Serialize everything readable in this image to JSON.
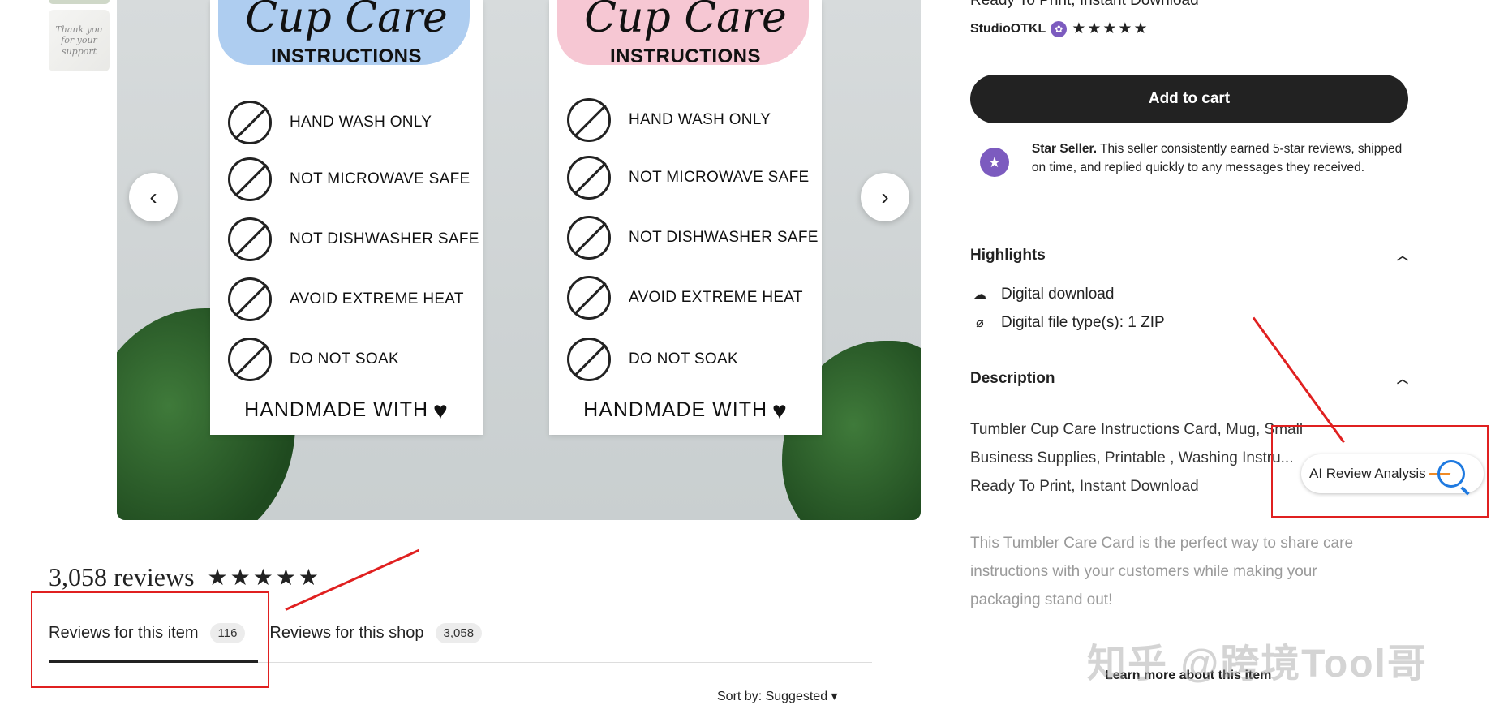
{
  "product": {
    "subtitle_cut": "Ready To Print, Instant Download",
    "seller_name": "StudioOTKL",
    "seller_badge": "✿",
    "seller_stars": "★★★★★",
    "add_to_cart": "Add to cart",
    "star_seller_label": "Star Seller.",
    "star_seller_text": "This seller consistently earned 5-star reviews, shipped on time, and replied quickly to any messages they received."
  },
  "thumbnail": {
    "caption": "Thank you for your support"
  },
  "hero_image": {
    "card_title": "Cup Care",
    "card_subtitle": "INSTRUCTIONS",
    "rules": [
      "HAND WASH ONLY",
      "NOT MICROWAVE SAFE",
      "NOT DISHWASHER SAFE",
      "AVOID EXTREME HEAT",
      "DO NOT SOAK"
    ],
    "footer": "HANDMADE WITH",
    "left_splash_color": "#aecdf0",
    "right_splash_color": "#f6c7d3",
    "prev_icon": "chevron-left-icon",
    "next_icon": "chevron-right-icon"
  },
  "highlights": {
    "heading": "Highlights",
    "items": [
      {
        "icon": "cloud-download-icon",
        "label": "Digital download"
      },
      {
        "icon": "paperclip-icon",
        "label": "Digital file type(s): 1 ZIP"
      }
    ]
  },
  "description": {
    "heading": "Description",
    "line1": "Tumbler Cup Care Instructions Card, Mug, Small",
    "line2": "Business Supplies, Printable , Washing Instru...",
    "line3": "Ready To Print, Instant Download",
    "fade1": "This Tumbler Care Card is the perfect way to share care",
    "fade2": "instructions with your customers while making your",
    "fade3": "packaging stand out!",
    "learn_more": "Learn more about this item"
  },
  "ai_widget": {
    "label": "AI Review Analysis"
  },
  "reviews": {
    "title": "3,058 reviews",
    "stars": "★★★★★",
    "tab_item_label": "Reviews for this item",
    "tab_item_count": "116",
    "tab_shop_label": "Reviews for this shop",
    "tab_shop_count": "3,058",
    "sort_label": "Sort by: Suggested"
  },
  "watermark": "知乎 @跨境Tool哥",
  "colors": {
    "accent_red": "#e02020",
    "button_dark": "#222222",
    "star_seller_purple": "#7c5bbf"
  }
}
